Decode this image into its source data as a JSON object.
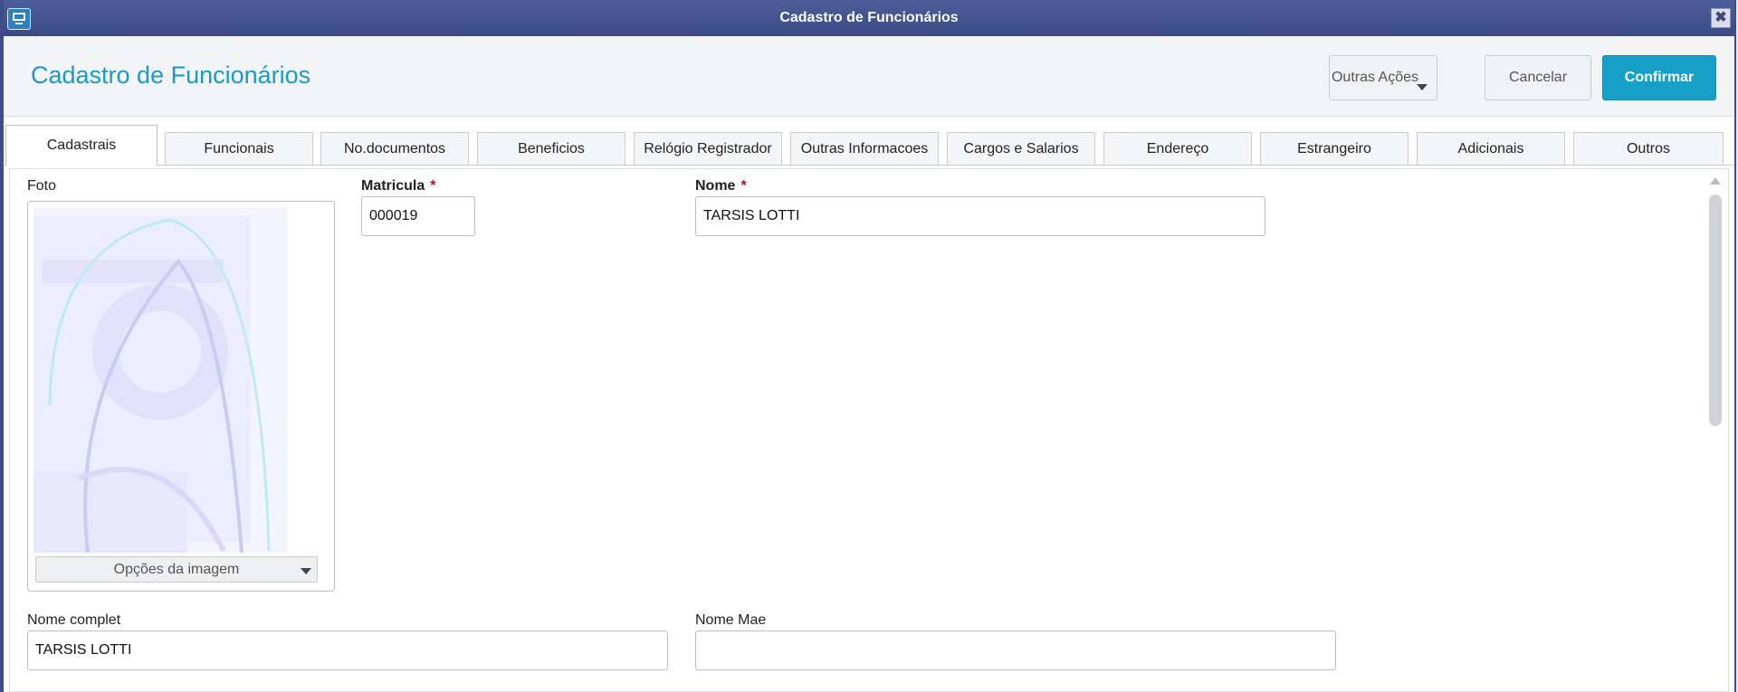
{
  "window": {
    "title": "Cadastro de Funcionários",
    "close_glyph": "✖"
  },
  "header": {
    "title": "Cadastro de Funcionários",
    "more_actions": "Outras Ações",
    "cancel": "Cancelar",
    "confirm": "Confirmar"
  },
  "tabs": [
    {
      "label": "Cadastrais",
      "active": true
    },
    {
      "label": "Funcionais"
    },
    {
      "label": "No.documentos"
    },
    {
      "label": "Beneficios"
    },
    {
      "label": "Relógio Registrador"
    },
    {
      "label": "Outras Informacoes"
    },
    {
      "label": "Cargos e Salarios"
    },
    {
      "label": "Endereço"
    },
    {
      "label": "Estrangeiro"
    },
    {
      "label": "Adicionais"
    },
    {
      "label": "Outros"
    }
  ],
  "form": {
    "photo_label": "Foto",
    "image_options": "Opções da imagem",
    "matricula_label": "Matricula",
    "matricula_value": "000019",
    "nome_label": "Nome",
    "nome_value": "TARSIS LOTTI",
    "nome_completo_label": "Nome complet",
    "nome_completo_value": "TARSIS LOTTI",
    "nome_mae_label": "Nome Mae",
    "nome_mae_value": "",
    "required_mark": "*"
  },
  "colors": {
    "titlebar": "#3f4e8a",
    "accent": "#1a9ac4",
    "confirm_bg": "#16a0c8",
    "required": "#d0021b"
  },
  "icons": [
    "app-window-icon",
    "close-icon",
    "chevron-down-icon",
    "scroll-up-arrow-icon"
  ]
}
